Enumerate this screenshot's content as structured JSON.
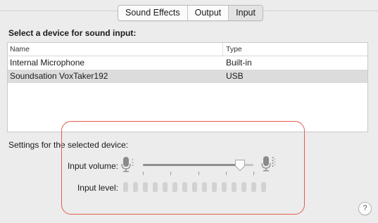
{
  "tabs": [
    {
      "label": "Sound Effects",
      "selected": false
    },
    {
      "label": "Output",
      "selected": false
    },
    {
      "label": "Input",
      "selected": true
    }
  ],
  "heading": "Select a device for sound input:",
  "table": {
    "columns": [
      "Name",
      "Type"
    ],
    "rows": [
      {
        "name": "Internal Microphone",
        "type": "Built-in",
        "selected": false
      },
      {
        "name": "Soundsation VoxTaker192",
        "type": "USB",
        "selected": true
      }
    ]
  },
  "settings_label": "Settings for the selected device:",
  "input_volume": {
    "label": "Input volume:",
    "value_fraction": 0.88
  },
  "input_level": {
    "label": "Input level:",
    "segments": 15,
    "active": 0
  },
  "help_label": "?",
  "colors": {
    "highlight": "#e65a4d",
    "selected_row": "#dcdcdc",
    "window_bg": "#ececec"
  },
  "icons": [
    "microphone-low-icon",
    "microphone-high-icon",
    "help-icon"
  ]
}
